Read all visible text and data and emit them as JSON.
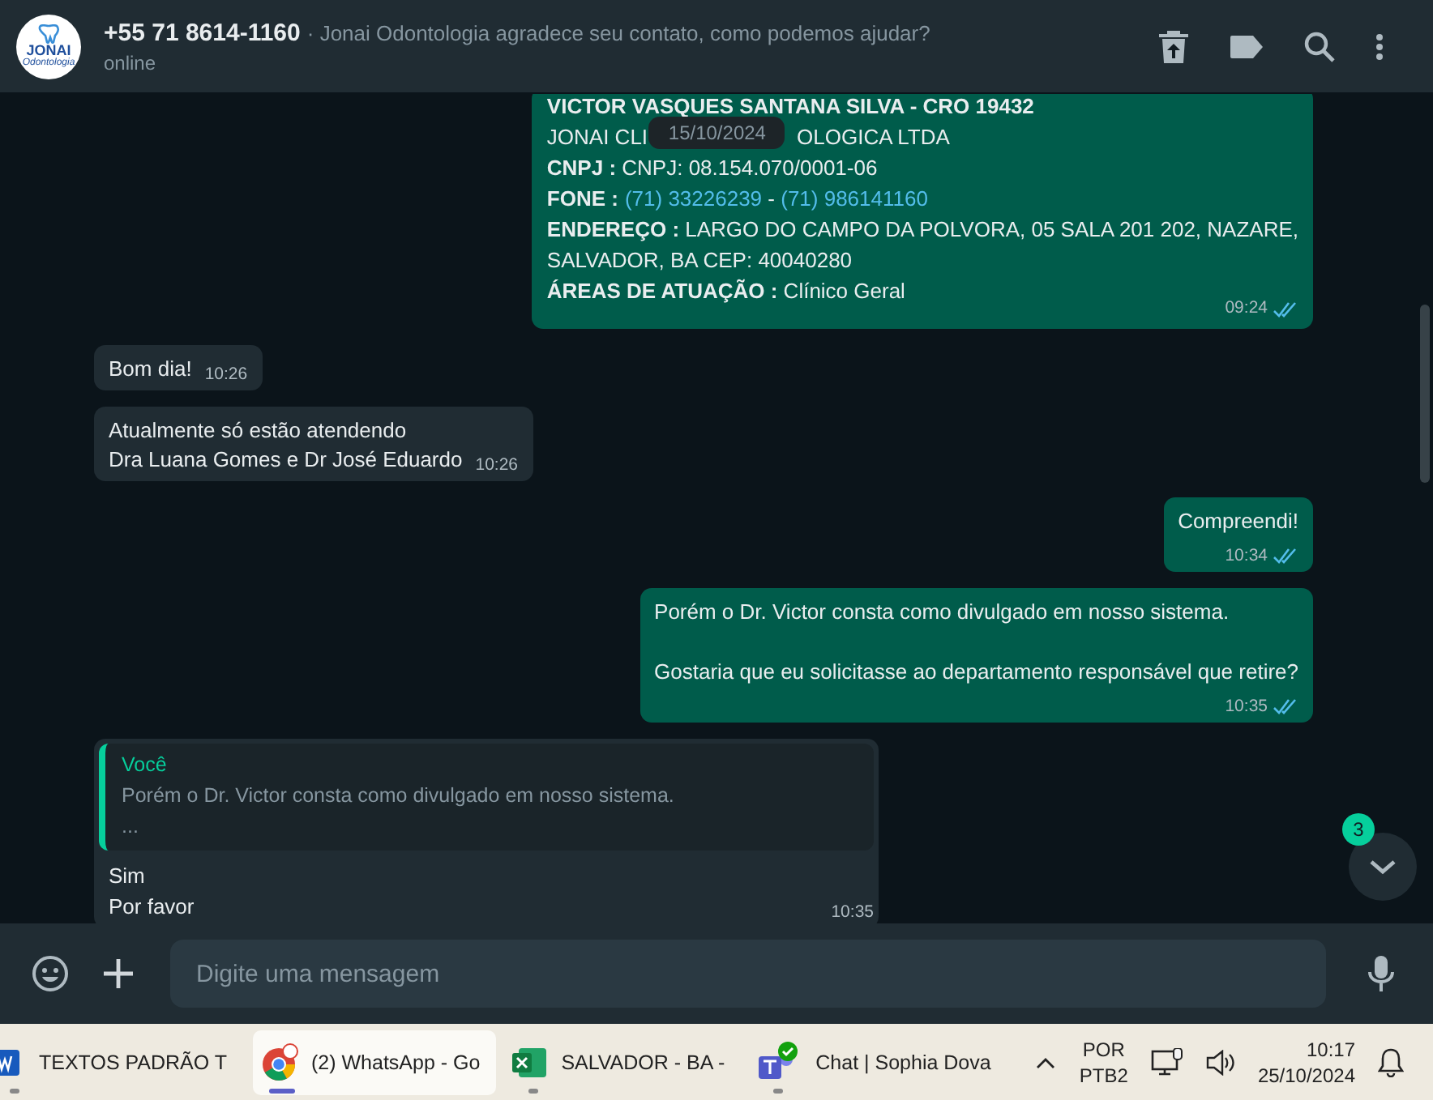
{
  "header": {
    "title": "+55 71 8614-1160",
    "subtitle": "· Jonai Odontologia agradece seu contato, como podemos ajudar?",
    "status": "online",
    "avatar_text": [
      "JONAI",
      "Odontologia"
    ]
  },
  "date_chip": "15/10/2024",
  "messages": [
    {
      "kind": "card",
      "outgoing": true,
      "time": "09:24",
      "read": true,
      "lines": [
        [
          {
            "kind": "bold",
            "text": "VICTOR VASQUES SANTANA SILVA - CRO 19432"
          }
        ],
        [
          {
            "kind": "plain",
            "text": "JONAI CLI"
          },
          {
            "kind": "gap"
          },
          {
            "kind": "plain",
            "text": "OLOGICA LTDA"
          }
        ],
        [
          {
            "kind": "bold",
            "text": "CNPJ :"
          },
          {
            "kind": "plain",
            "text": " CNPJ: 08.154.070/0001-06"
          }
        ],
        [
          {
            "kind": "bold",
            "text": "FONE :"
          },
          {
            "kind": "link",
            "text": "(71) 33226239"
          },
          {
            "kind": "plain",
            "text": " - "
          },
          {
            "kind": "link",
            "text": "(71) 986141160"
          }
        ],
        [
          {
            "kind": "bold",
            "text": "ENDEREÇO :"
          },
          {
            "kind": "plain",
            "text": " LARGO DO CAMPO DA POLVORA, 05 SALA 201 202, NAZARE,"
          }
        ],
        [
          {
            "kind": "plain",
            "text": "SALVADOR, BA CEP: 40040280"
          }
        ],
        [
          {
            "kind": "bold",
            "text": "ÁREAS DE ATUAÇÃO :"
          },
          {
            "kind": "plain",
            "text": " Clínico Geral"
          }
        ]
      ]
    },
    {
      "kind": "text",
      "outgoing": false,
      "time": "10:26",
      "paragraphs": [
        "Bom dia!"
      ]
    },
    {
      "kind": "text",
      "outgoing": false,
      "time": "10:26",
      "paragraphs": [
        "Atualmente só estão atendendo\nDra Luana Gomes e Dr José Eduardo"
      ]
    },
    {
      "kind": "text",
      "outgoing": true,
      "time": "10:34",
      "read": true,
      "paragraphs": [
        "Compreendi!"
      ]
    },
    {
      "kind": "text",
      "outgoing": true,
      "time": "10:35",
      "read": true,
      "paragraphs": [
        "Porém o Dr. Victor consta como divulgado em nosso sistema.",
        "Gostaria que eu solicitasse ao departamento responsável que retire?"
      ]
    },
    {
      "kind": "reply",
      "outgoing": false,
      "time": "10:35",
      "quote_author": "Você",
      "quote_text": "Porém o Dr. Victor consta como divulgado em nosso sistema.",
      "quote_more": "...",
      "paragraphs": [
        "Sim\nPor favor"
      ]
    }
  ],
  "unread_badge": "3",
  "composer": {
    "placeholder": "Digite uma mensagem"
  },
  "taskbar": {
    "apps": [
      {
        "kind": "word",
        "label": "TEXTOS PADRÃO T",
        "selected": false
      },
      {
        "kind": "chrome",
        "label": "(2) WhatsApp - Go",
        "selected": true
      },
      {
        "kind": "excel",
        "label": "SALVADOR - BA -",
        "selected": false
      },
      {
        "kind": "teams",
        "label": "Chat | Sophia Dova",
        "selected": false
      }
    ],
    "language": [
      "POR",
      "PTB2"
    ],
    "time": "10:17",
    "date": "25/10/2024"
  }
}
